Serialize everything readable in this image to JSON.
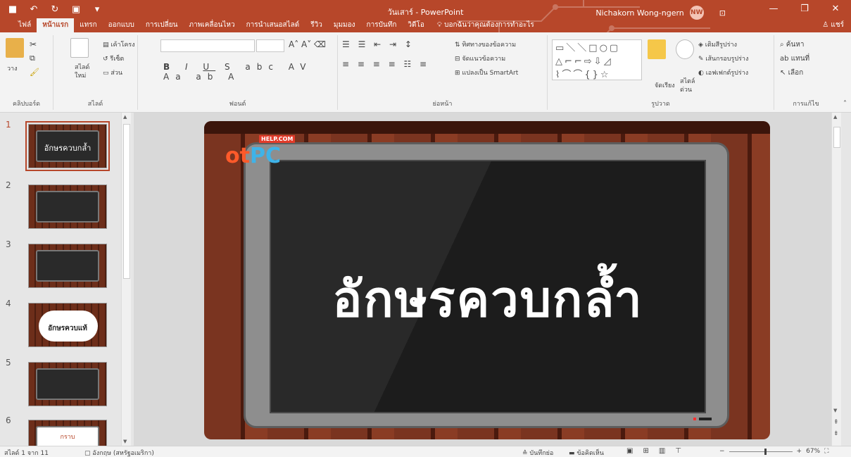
{
  "titlebar": {
    "title": "วันเสาร์ - PowerPoint",
    "user_name": "Nichakorn Wong-ngern",
    "user_initials": "NW"
  },
  "tabs": [
    "ไฟล์",
    "หน้าแรก",
    "แทรก",
    "ออกแบบ",
    "การเปลี่ยน",
    "ภาพเคลื่อนไหว",
    "การนำเสนอสไลด์",
    "รีวิว",
    "มุมมอง",
    "การบันทึก",
    "วิดีโอ"
  ],
  "active_tab": "หน้าแรก",
  "tell_me": "บอกฉันว่าคุณต้องการทำอะไร",
  "share": "แชร์",
  "ribbon": {
    "clipboard": {
      "label": "คลิปบอร์ด",
      "paste": "วาง"
    },
    "slides": {
      "label": "สไลด์",
      "new_slide": "สไลด์",
      "new_slide_2": "ใหม่",
      "layout": "เค้าโครง",
      "reset": "รีเซ็ต",
      "section": "ส่วน"
    },
    "font": {
      "label": "ฟอนต์"
    },
    "paragraph": {
      "label": "ย่อหน้า",
      "text_direction": "ทิศทางของข้อความ",
      "align_text": "จัดแนวข้อความ",
      "smartart": "แปลงเป็น SmartArt"
    },
    "drawing": {
      "label": "รูปวาด",
      "arrange": "จัดเรียง",
      "quick_styles": "สไตล์",
      "quick_styles_2": "ด่วน",
      "fill": "เติมสีรูปร่าง",
      "outline": "เส้นกรอบรูปร่าง",
      "effects": "เอฟเฟกต์รูปร่าง"
    },
    "editing": {
      "label": "การแก้ไข",
      "find": "ค้นหา",
      "replace": "แทนที่",
      "select": "เลือก"
    }
  },
  "thumbnails": [
    {
      "num": "1",
      "text": "อักษรควบกล้ำ",
      "style": "screen"
    },
    {
      "num": "2",
      "text": "",
      "style": "screen"
    },
    {
      "num": "3",
      "text": "",
      "style": "screen"
    },
    {
      "num": "4",
      "text": "อักษรควบแท้",
      "style": "cloud"
    },
    {
      "num": "5",
      "text": "",
      "style": "screen"
    },
    {
      "num": "6",
      "text": "กราบ",
      "style": "screen"
    }
  ],
  "slide": {
    "title": "อักษรควบกล้ำ",
    "logo_badge": "HELP.COM",
    "logo_ot": "ot",
    "logo_pc": "PC"
  },
  "status": {
    "slide_of": "สไลด์ 1 จาก 11",
    "language": "อังกฤษ (สหรัฐอเมริกา)",
    "notes": "บันทึกย่อ",
    "comments": "ข้อคิดเห็น",
    "zoom": "67%"
  }
}
